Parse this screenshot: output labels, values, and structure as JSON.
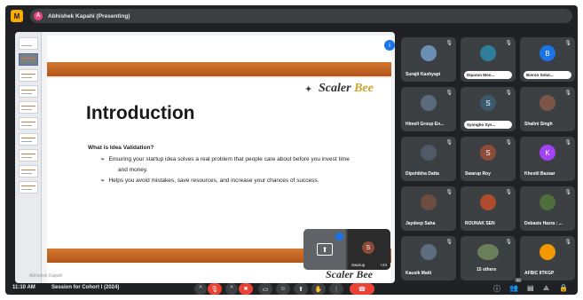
{
  "app": {
    "icon_letter": "M"
  },
  "topbar": {
    "avatar_letter": "A",
    "presenter_label": "Abhishek Kapahi (Presenting)"
  },
  "slide": {
    "title": "Introduction",
    "logo_text": "Scaler",
    "logo_accent": "Bee",
    "question": "What is Idea Validation?",
    "bullets": [
      "Ensuring your startup idea solves a real problem that people care about before you invest time",
      "and money.",
      "Helps you avoid mistakes, save resources, and increase your chances of success."
    ],
    "footer_text": "Abhishek Kapahi",
    "footer_logo": "Scaler Bee",
    "accent_color": "#c8651f"
  },
  "pip": {
    "avatar_letter": "S",
    "name": "Swarup",
    "count": "+24"
  },
  "participants": [
    {
      "name": "Surajit Kashyapi",
      "style": "photo",
      "color": "#6b8fb3",
      "letter": ""
    },
    {
      "name": "Diparun Mon...",
      "style": "pill",
      "color": "#2e7d9b",
      "letter": ""
    },
    {
      "name": "Bieron Solut...",
      "style": "pill",
      "color": "#1a73e8",
      "letter": "B"
    },
    {
      "name": "Himell Group En...",
      "style": "photo",
      "color": "#5a6b7c",
      "letter": ""
    },
    {
      "name": "Syongbo Sys...",
      "style": "pill",
      "color": "#3b5a6b",
      "letter": "S"
    },
    {
      "name": "Shalini Singh",
      "style": "photo",
      "color": "#7a5548",
      "letter": ""
    },
    {
      "name": "Dipshikha Datta",
      "style": "photo",
      "color": "#4f5a66",
      "letter": ""
    },
    {
      "name": "Swarup Roy",
      "style": "plain",
      "color": "#8d4b3a",
      "letter": "S"
    },
    {
      "name": "Khestil Bazaar",
      "style": "plain",
      "color": "#a142f4",
      "letter": "K"
    },
    {
      "name": "Jaydeep Saha",
      "style": "photo",
      "color": "#6d4c41",
      "letter": ""
    },
    {
      "name": "ROUNAK SEN",
      "style": "photo",
      "color": "#b04a2c",
      "letter": ""
    },
    {
      "name": "Debasis Hazra : ...",
      "style": "photo",
      "color": "#4e6e3a",
      "letter": ""
    },
    {
      "name": "Kausik Maiti",
      "style": "photo",
      "color": "#5d6d7e",
      "letter": ""
    },
    {
      "name": "15 others",
      "style": "others",
      "color": "#6a7f5a",
      "letter": ""
    },
    {
      "name": "AFBIC IITKGP",
      "style": "plain",
      "color": "#f29900",
      "letter": ""
    }
  ],
  "bottombar": {
    "time": "11:10 AM",
    "meeting_name": "Session for Cohort I (2024)",
    "people_count": "30"
  },
  "icons": {
    "mic": "mic-icon",
    "camera": "camera-icon",
    "captions": "captions-icon",
    "emoji": "emoji-icon",
    "present": "present-icon",
    "hand": "raise-hand-icon",
    "more": "more-icon",
    "leave": "leave-call-icon",
    "info": "info-icon",
    "people": "people-icon",
    "chat": "chat-icon",
    "activities": "activities-icon",
    "lock": "host-controls-icon"
  }
}
